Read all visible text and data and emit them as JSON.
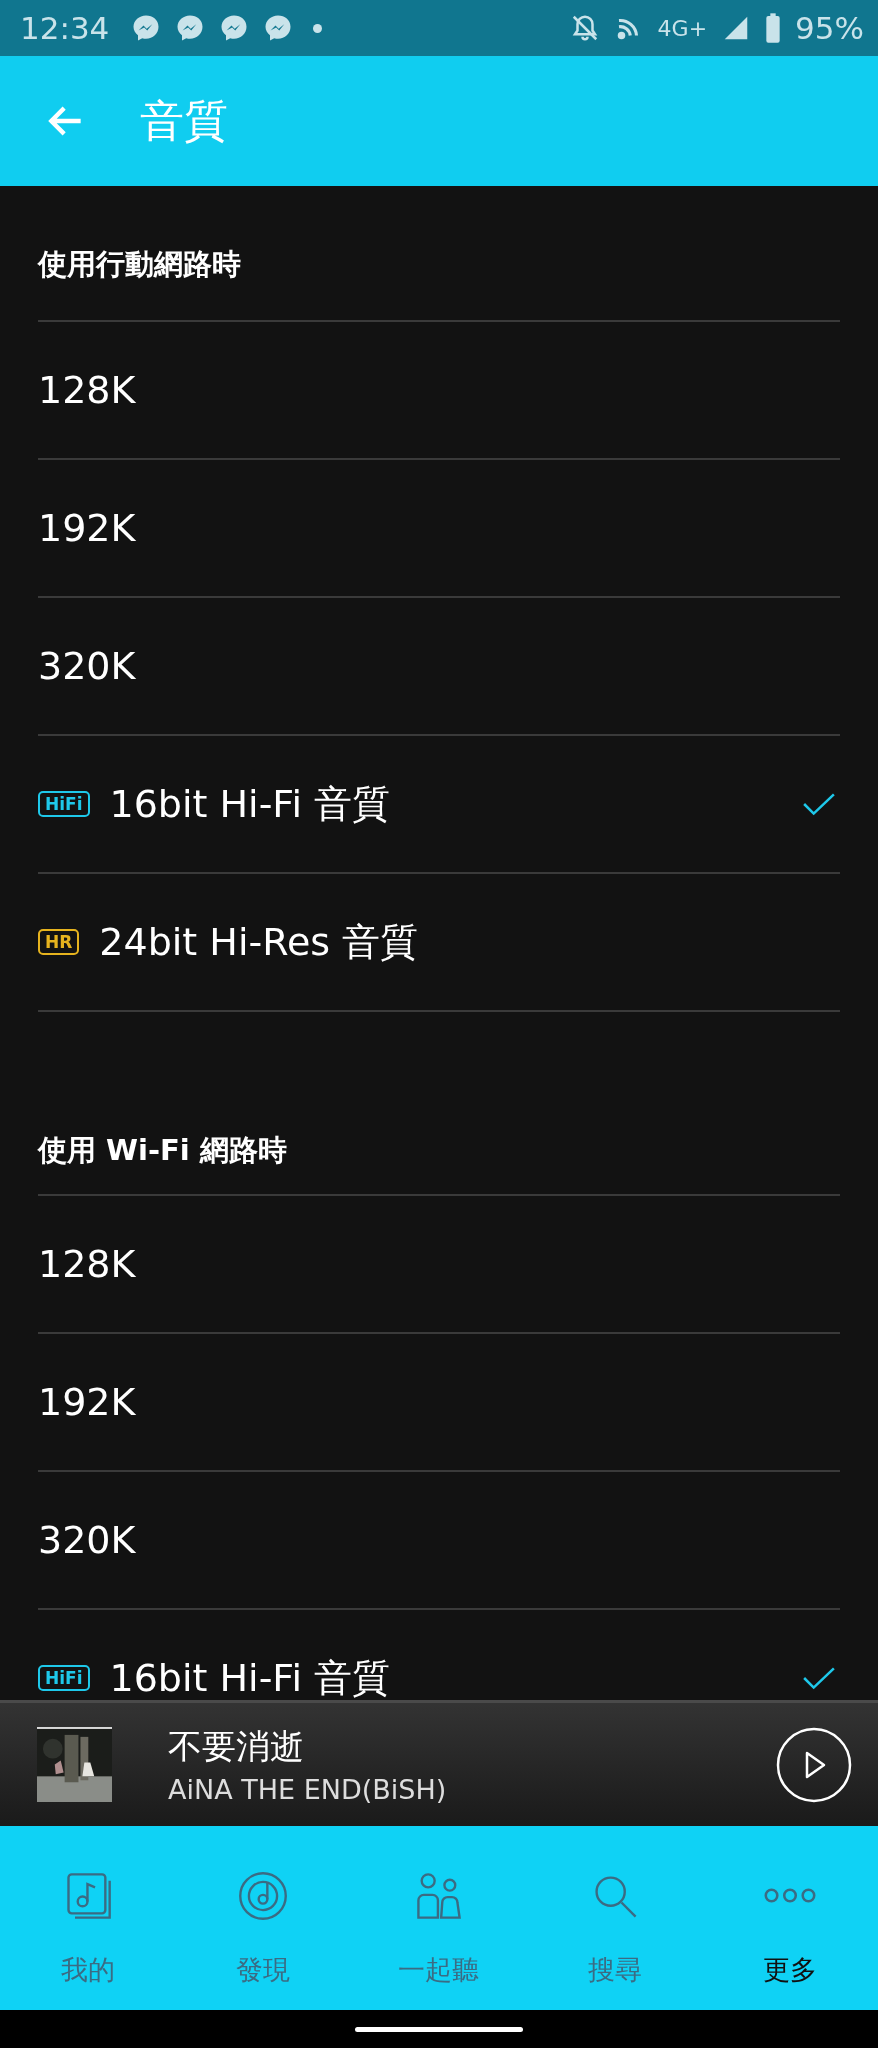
{
  "status_bar": {
    "time": "12:34",
    "network": "4G+",
    "battery": "95%"
  },
  "header": {
    "title": "音質"
  },
  "sections": [
    {
      "title": "使用行動網路時",
      "options": [
        {
          "label": "128K",
          "selected": false
        },
        {
          "label": "192K",
          "selected": false
        },
        {
          "label": "320K",
          "selected": false
        },
        {
          "label": "16bit Hi-Fi 音質",
          "badge": {
            "kind": "hifi",
            "text": "HiFi"
          },
          "selected": true
        },
        {
          "label": "24bit Hi-Res 音質",
          "badge": {
            "kind": "hr",
            "text": "HR"
          },
          "selected": false
        }
      ]
    },
    {
      "title": "使用 Wi-Fi 網路時",
      "options": [
        {
          "label": "128K",
          "selected": false
        },
        {
          "label": "192K",
          "selected": false
        },
        {
          "label": "320K",
          "selected": false
        },
        {
          "label": "16bit Hi-Fi 音質",
          "badge": {
            "kind": "hifi",
            "text": "HiFi"
          },
          "selected": true
        }
      ]
    }
  ],
  "player": {
    "title": "不要消逝",
    "artist": "AiNA THE END(BiSH)"
  },
  "nav": [
    {
      "kind": "library",
      "label": "我的",
      "selected": false
    },
    {
      "kind": "discover",
      "label": "發現",
      "selected": false
    },
    {
      "kind": "together",
      "label": "一起聽",
      "selected": false
    },
    {
      "kind": "search",
      "label": "搜尋",
      "selected": false
    },
    {
      "kind": "more",
      "label": "更多",
      "selected": true
    }
  ]
}
